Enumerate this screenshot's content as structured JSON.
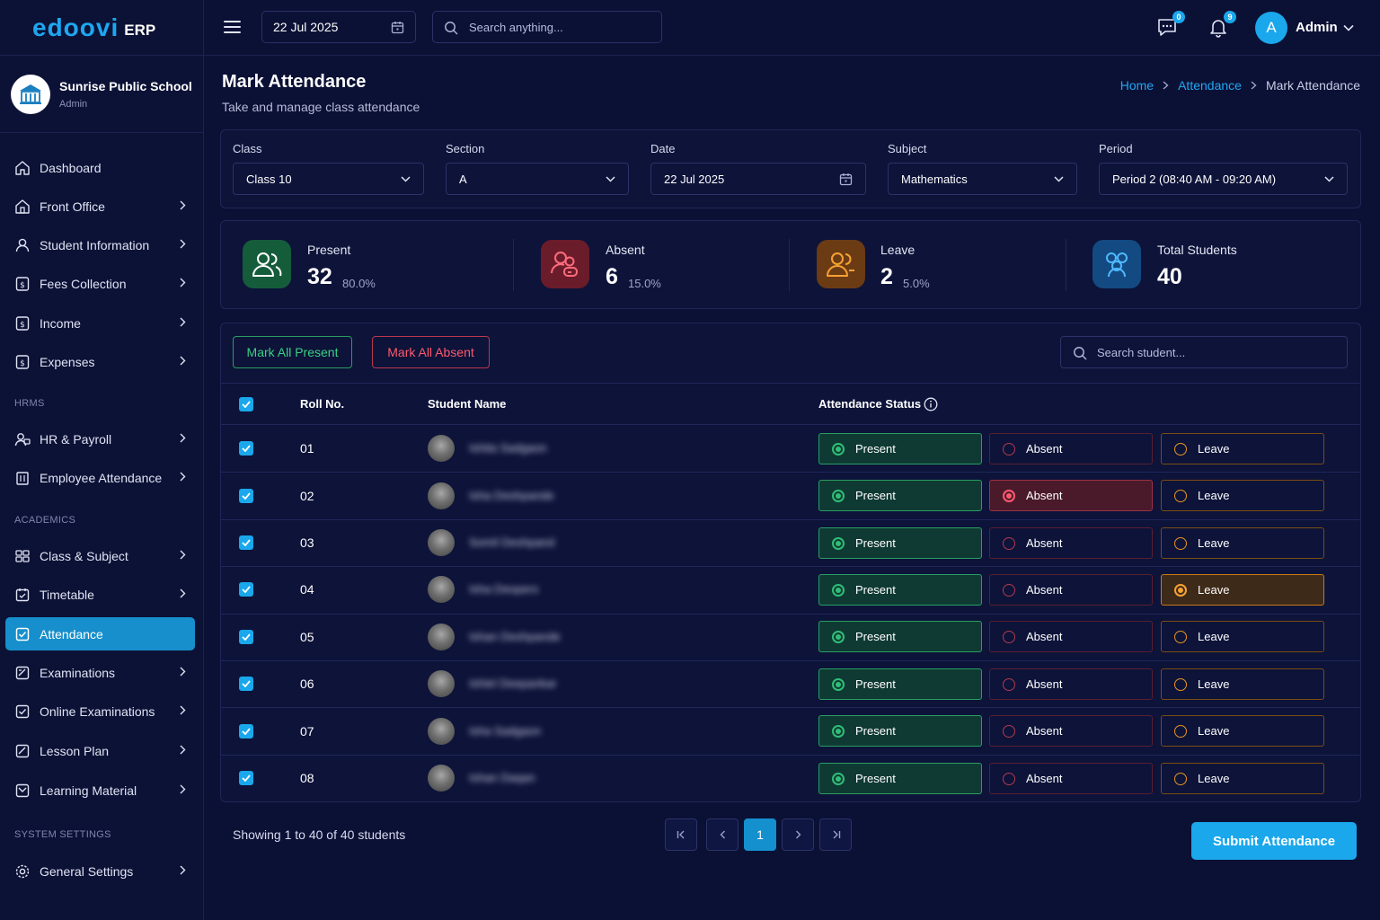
{
  "app": {
    "logo": "edoovi",
    "logo_suffix": "ERP"
  },
  "school": {
    "name": "Sunrise Public School",
    "role": "Admin"
  },
  "topbar": {
    "date": "22 Jul 2025",
    "search_placeholder": "Search anything...",
    "messages_count": "0",
    "notifications_count": "9",
    "user_initial": "A",
    "user_name": "Admin"
  },
  "sidebar": {
    "items": [
      {
        "label": "Dashboard",
        "icon": "home-icon"
      },
      {
        "label": "Front Office",
        "icon": "front-office-icon"
      },
      {
        "label": "Student Information",
        "icon": "user-icon"
      },
      {
        "label": "Fees Collection",
        "icon": "fees-icon"
      },
      {
        "label": "Income",
        "icon": "income-icon"
      },
      {
        "label": "Expenses",
        "icon": "expenses-icon"
      },
      {
        "label": "HR & Payroll",
        "icon": "hr-icon"
      },
      {
        "label": "Employee Attendance",
        "icon": "building-icon"
      },
      {
        "label": "Class & Subject",
        "icon": "class-icon"
      },
      {
        "label": "Timetable",
        "icon": "calendar-icon"
      },
      {
        "label": "Attendance",
        "icon": "attendance-icon"
      },
      {
        "label": "Examinations",
        "icon": "exam-icon"
      },
      {
        "label": "Online Examinations",
        "icon": "online-exam-icon"
      },
      {
        "label": "Lesson Plan",
        "icon": "lesson-icon"
      },
      {
        "label": "Learning Material",
        "icon": "material-icon"
      },
      {
        "label": "General Settings",
        "icon": "settings-icon"
      }
    ],
    "sections": {
      "hrms": "HRMS",
      "academics": "ACADEMICS",
      "system": "SYSTEM SETTINGS"
    },
    "active": "Attendance"
  },
  "page": {
    "title": "Mark Attendance",
    "subtitle": "Take and manage class attendance"
  },
  "breadcrumb": {
    "home": "Home",
    "section": "Attendance",
    "current": "Mark Attendance"
  },
  "filters": {
    "class_label": "Class",
    "class_value": "Class 10",
    "section_label": "Section",
    "section_value": "A",
    "date_label": "Date",
    "date_value": "22 Jul 2025",
    "subject_label": "Subject",
    "subject_value": "Mathematics",
    "period_label": "Period",
    "period_value": "Period 2 (08:40 AM - 09:20 AM)"
  },
  "stats": {
    "present": {
      "label": "Present",
      "value": "32",
      "pct": "80.0%"
    },
    "absent": {
      "label": "Absent",
      "value": "6",
      "pct": "15.0%"
    },
    "leave": {
      "label": "Leave",
      "value": "2",
      "pct": "5.0%"
    },
    "total": {
      "label": "Total Students",
      "value": "40"
    }
  },
  "actions": {
    "mark_present": "Mark All Present",
    "mark_absent": "Mark All Absent",
    "student_search_placeholder": "Search student..."
  },
  "table": {
    "headers": {
      "roll": "Roll No.",
      "name": "Student Name",
      "status": "Attendance Status"
    },
    "option_labels": {
      "present": "Present",
      "absent": "Absent",
      "leave": "Leave"
    },
    "rows": [
      {
        "roll": "01",
        "name": "Ishita Sadgaon",
        "present": true,
        "absent": false,
        "leave": false
      },
      {
        "roll": "02",
        "name": "Isha Deshpande",
        "present": true,
        "absent": true,
        "leave": false
      },
      {
        "roll": "03",
        "name": "Somil Deshpand",
        "present": true,
        "absent": false,
        "leave": false
      },
      {
        "roll": "04",
        "name": "Isha Deopers",
        "present": true,
        "absent": false,
        "leave": true
      },
      {
        "roll": "05",
        "name": "Ishan Deshpande",
        "present": true,
        "absent": false,
        "leave": false
      },
      {
        "roll": "06",
        "name": "Ishiel Deepankar",
        "present": true,
        "absent": false,
        "leave": false
      },
      {
        "roll": "07",
        "name": "Isha Sadgaon",
        "present": true,
        "absent": false,
        "leave": false
      },
      {
        "roll": "08",
        "name": "Ishan Daqan",
        "present": true,
        "absent": false,
        "leave": false
      }
    ]
  },
  "footer": {
    "showing": "Showing 1 to 40 of 40 students",
    "current_page": "1",
    "submit": "Submit Attendance"
  },
  "colors": {
    "accent": "#1aa7ec",
    "present": "#2fbe76",
    "absent": "#ff5a6e",
    "leave": "#f7a233",
    "background": "#0b1035"
  }
}
